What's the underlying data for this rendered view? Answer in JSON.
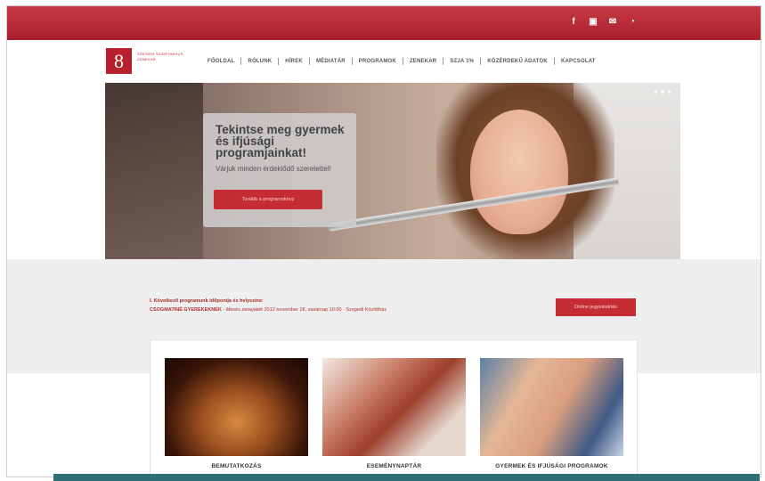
{
  "topbar": {
    "social": [
      {
        "icon": "facebook-icon",
        "glyph": "f"
      },
      {
        "icon": "youtube-icon",
        "glyph": "▣"
      },
      {
        "icon": "mail-icon",
        "glyph": "✉"
      },
      {
        "icon": "rss-icon",
        "glyph": "◔"
      }
    ],
    "color": "#b8202e"
  },
  "header": {
    "logo_mark": "8",
    "logo_text": "SZEGEDI SZIMFONIKUS ZENEKAR",
    "nav": [
      "FŐOLDAL",
      "RÓLUNK",
      "HÍREK",
      "MÉDIATÁR",
      "PROGRAMOK",
      "ZENEKAR",
      "SZJA 1%",
      "KÖZÉRDEKŰ ADATOK",
      "KAPCSOLAT"
    ]
  },
  "hero": {
    "title": "Tekintse meg gyermek és ifjúsági programjainkat!",
    "subtitle": "Várjuk minden érdeklődő szeretettel!",
    "button": "Tovább a programokhoz"
  },
  "announcement": {
    "line1": "I. Következő programunk időpontja és helyszíne:",
    "line2_bold": "CSOGMATINÉ GYEREKEKNEK",
    "line2_italic": " - Mesés zenejáték",
    "line2_rest": " 2012 november 18, vasárnap 10:00 · Szegedi Közöttház",
    "button": "Online jegyvásárlás"
  },
  "cards": [
    {
      "label": "BEMUTATKOZÁS"
    },
    {
      "label": "ESEMÉNYNAPTÁR"
    },
    {
      "label": "GYERMEK ÉS IFJÚSÁGI PROGRAMOK"
    }
  ]
}
